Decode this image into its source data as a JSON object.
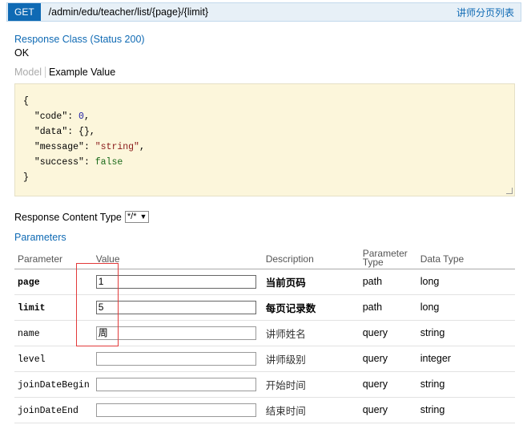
{
  "operation": {
    "method": "GET",
    "path": "/admin/edu/teacher/list/{page}/{limit}",
    "summary": "讲师分页列表"
  },
  "response": {
    "class_label": "Response Class (Status 200)",
    "status_text": "OK"
  },
  "tabs": {
    "model": "Model",
    "example": "Example Value"
  },
  "example": {
    "open": "{",
    "close": "}",
    "fields": [
      {
        "key": "\"code\"",
        "value": "0",
        "kind": "n",
        "comma": ","
      },
      {
        "key": "\"data\"",
        "value": "{}",
        "kind": "k",
        "comma": ","
      },
      {
        "key": "\"message\"",
        "value": "\"string\"",
        "kind": "s",
        "comma": ","
      },
      {
        "key": "\"success\"",
        "value": "false",
        "kind": "b",
        "comma": ""
      }
    ]
  },
  "content_type": {
    "label": "Response Content Type",
    "selected": "*/*"
  },
  "parameters": {
    "title": "Parameters",
    "headers": {
      "parameter": "Parameter",
      "value": "Value",
      "description": "Description",
      "param_type_1": "Parameter",
      "param_type_2": "Type",
      "data_type": "Data Type"
    },
    "rows": [
      {
        "name": "page",
        "value": "1",
        "description": "当前页码",
        "param_type": "path",
        "data_type": "long",
        "required": true
      },
      {
        "name": "limit",
        "value": "5",
        "description": "每页记录数",
        "param_type": "path",
        "data_type": "long",
        "required": true
      },
      {
        "name": "name",
        "value": "周",
        "description": "讲师姓名",
        "param_type": "query",
        "data_type": "string",
        "required": false
      },
      {
        "name": "level",
        "value": "",
        "description": "讲师级别",
        "param_type": "query",
        "data_type": "integer",
        "required": false
      },
      {
        "name": "joinDateBegin",
        "value": "",
        "description": "开始时间",
        "param_type": "query",
        "data_type": "string",
        "required": false
      },
      {
        "name": "joinDateEnd",
        "value": "",
        "description": "结束时间",
        "param_type": "query",
        "data_type": "string",
        "required": false
      }
    ]
  },
  "colors": {
    "accent": "#0f6ab4",
    "highlight_border": "#e23a3a",
    "example_bg": "#fcf6db"
  }
}
